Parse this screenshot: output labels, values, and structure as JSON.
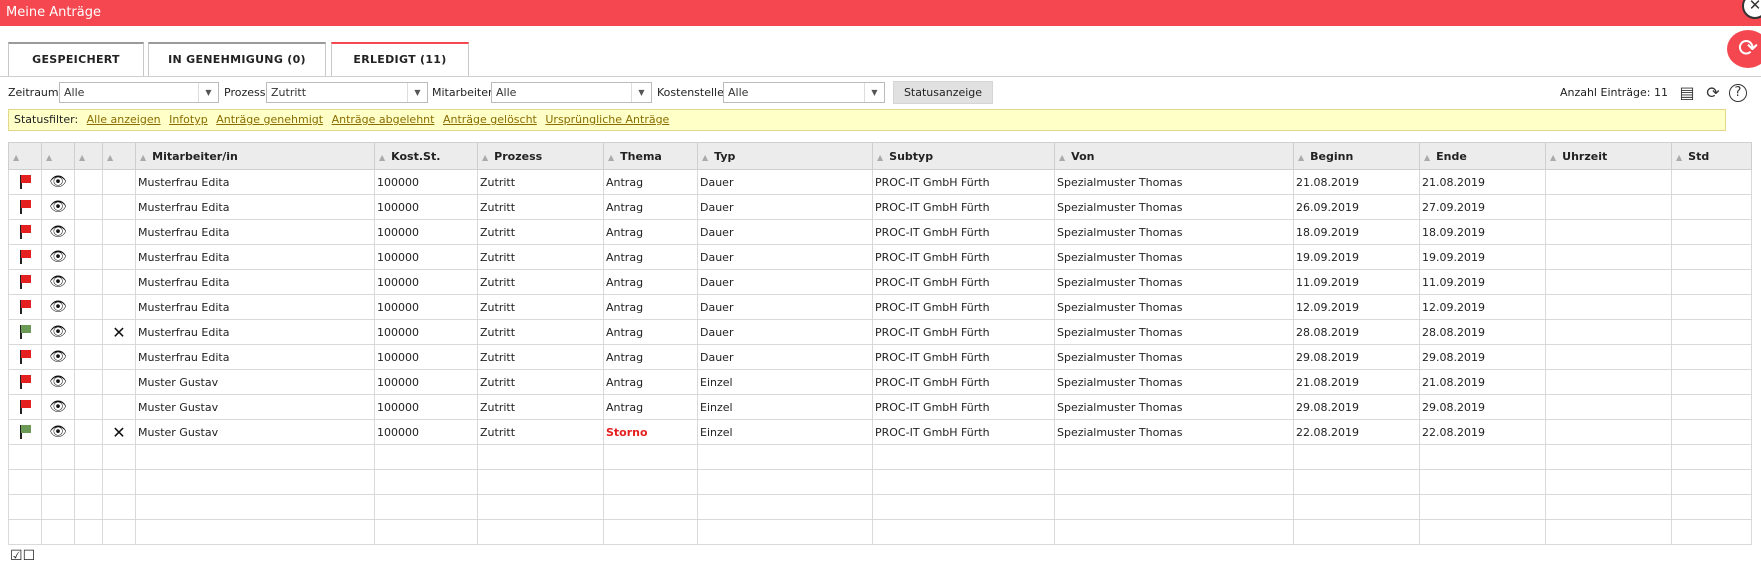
{
  "window": {
    "title": "Meine Anträge"
  },
  "tabs": [
    {
      "label": "GESPEICHERT"
    },
    {
      "label": "IN GENEHMIGUNG (0)"
    },
    {
      "label": "ERLEDIGT (11)"
    }
  ],
  "filters": {
    "zeitraum": {
      "label": "Zeitraum",
      "value": "Alle"
    },
    "prozess": {
      "label": "Prozess",
      "value": "Zutritt"
    },
    "mitarbeiter": {
      "label": "Mitarbeiter",
      "value": "Alle"
    },
    "kostenstelle": {
      "label": "Kostenstelle",
      "value": "Alle"
    },
    "status_button": "Statusanzeige",
    "count_label": "Anzahl Einträge: 11"
  },
  "statusfilter": {
    "label": "Statusfilter:",
    "links": [
      "Alle anzeigen",
      "Infotyp",
      "Anträge genehmigt",
      "Anträge abgelehnt",
      "Anträge gelöscht",
      "Ursprüngliche Anträge"
    ]
  },
  "table": {
    "columns": [
      "Mitarbeiter/in",
      "Kost.St.",
      "Prozess",
      "Thema",
      "Typ",
      "Subtyp",
      "Von",
      "Beginn",
      "Ende",
      "Uhrzeit",
      "Std"
    ],
    "rows": [
      {
        "flag": "red",
        "x": false,
        "mitarbeiter": "Musterfrau Edita",
        "kost": "100000",
        "prozess": "Zutritt",
        "thema": "Antrag",
        "typ": "Dauer",
        "subtyp": "PROC-IT GmbH Fürth",
        "von": "Spezialmuster Thomas",
        "beginn": "21.08.2019",
        "ende": "21.08.2019",
        "uhrzeit": "",
        "std": ""
      },
      {
        "flag": "red",
        "x": false,
        "mitarbeiter": "Musterfrau Edita",
        "kost": "100000",
        "prozess": "Zutritt",
        "thema": "Antrag",
        "typ": "Dauer",
        "subtyp": "PROC-IT GmbH Fürth",
        "von": "Spezialmuster Thomas",
        "beginn": "26.09.2019",
        "ende": "27.09.2019",
        "uhrzeit": "",
        "std": ""
      },
      {
        "flag": "red",
        "x": false,
        "mitarbeiter": "Musterfrau Edita",
        "kost": "100000",
        "prozess": "Zutritt",
        "thema": "Antrag",
        "typ": "Dauer",
        "subtyp": "PROC-IT GmbH Fürth",
        "von": "Spezialmuster Thomas",
        "beginn": "18.09.2019",
        "ende": "18.09.2019",
        "uhrzeit": "",
        "std": ""
      },
      {
        "flag": "red",
        "x": false,
        "mitarbeiter": "Musterfrau Edita",
        "kost": "100000",
        "prozess": "Zutritt",
        "thema": "Antrag",
        "typ": "Dauer",
        "subtyp": "PROC-IT GmbH Fürth",
        "von": "Spezialmuster Thomas",
        "beginn": "19.09.2019",
        "ende": "19.09.2019",
        "uhrzeit": "",
        "std": ""
      },
      {
        "flag": "red",
        "x": false,
        "mitarbeiter": "Musterfrau Edita",
        "kost": "100000",
        "prozess": "Zutritt",
        "thema": "Antrag",
        "typ": "Dauer",
        "subtyp": "PROC-IT GmbH Fürth",
        "von": "Spezialmuster Thomas",
        "beginn": "11.09.2019",
        "ende": "11.09.2019",
        "uhrzeit": "",
        "std": ""
      },
      {
        "flag": "red",
        "x": false,
        "mitarbeiter": "Musterfrau Edita",
        "kost": "100000",
        "prozess": "Zutritt",
        "thema": "Antrag",
        "typ": "Dauer",
        "subtyp": "PROC-IT GmbH Fürth",
        "von": "Spezialmuster Thomas",
        "beginn": "12.09.2019",
        "ende": "12.09.2019",
        "uhrzeit": "",
        "std": ""
      },
      {
        "flag": "green",
        "x": true,
        "mitarbeiter": "Musterfrau Edita",
        "kost": "100000",
        "prozess": "Zutritt",
        "thema": "Antrag",
        "typ": "Dauer",
        "subtyp": "PROC-IT GmbH Fürth",
        "von": "Spezialmuster Thomas",
        "beginn": "28.08.2019",
        "ende": "28.08.2019",
        "uhrzeit": "",
        "std": ""
      },
      {
        "flag": "red",
        "x": false,
        "mitarbeiter": "Musterfrau Edita",
        "kost": "100000",
        "prozess": "Zutritt",
        "thema": "Antrag",
        "typ": "Dauer",
        "subtyp": "PROC-IT GmbH Fürth",
        "von": "Spezialmuster Thomas",
        "beginn": "29.08.2019",
        "ende": "29.08.2019",
        "uhrzeit": "",
        "std": ""
      },
      {
        "flag": "red",
        "x": false,
        "mitarbeiter": "Muster Gustav",
        "kost": "100000",
        "prozess": "Zutritt",
        "thema": "Antrag",
        "typ": "Einzel",
        "subtyp": "PROC-IT GmbH Fürth",
        "von": "Spezialmuster Thomas",
        "beginn": "21.08.2019",
        "ende": "21.08.2019",
        "uhrzeit": "",
        "std": ""
      },
      {
        "flag": "red",
        "x": false,
        "mitarbeiter": "Muster Gustav",
        "kost": "100000",
        "prozess": "Zutritt",
        "thema": "Antrag",
        "typ": "Einzel",
        "subtyp": "PROC-IT GmbH Fürth",
        "von": "Spezialmuster Thomas",
        "beginn": "29.08.2019",
        "ende": "29.08.2019",
        "uhrzeit": "",
        "std": ""
      },
      {
        "flag": "green",
        "x": true,
        "mitarbeiter": "Muster Gustav",
        "kost": "100000",
        "prozess": "Zutritt",
        "thema": "Storno",
        "typ": "Einzel",
        "subtyp": "PROC-IT GmbH Fürth",
        "von": "Spezialmuster Thomas",
        "beginn": "22.08.2019",
        "ende": "22.08.2019",
        "uhrzeit": "",
        "std": "",
        "thema_color": "#e52020"
      }
    ]
  },
  "icons": {
    "close": "close-icon",
    "refresh_float": "refresh-icon",
    "export": "book-icon",
    "reload": "reload-icon",
    "help": "help-icon",
    "select_all": "checkbox-checked-icon",
    "deselect_all": "checkbox-empty-icon"
  },
  "colors": {
    "accent": "#f4474f",
    "flag_red": "#e52020",
    "flag_green": "#6a9a55",
    "statusfilter_bg": "#ffffc8"
  }
}
